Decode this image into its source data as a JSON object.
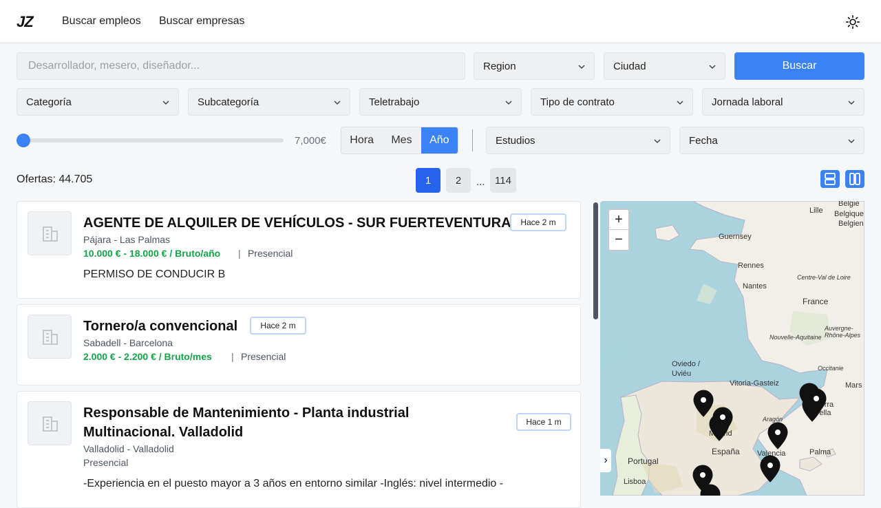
{
  "header": {
    "logo": "JZ",
    "nav": [
      "Buscar empleos",
      "Buscar empresas"
    ],
    "theme_icon": "sun-icon"
  },
  "filters": {
    "search_placeholder": "Desarrollador, mesero, diseñador...",
    "region": "Region",
    "ciudad": "Ciudad",
    "search_button": "Buscar",
    "categoria": "Categoría",
    "subcategoria": "Subcategoría",
    "teletrabajo": "Teletrabajo",
    "tipo_contrato": "Tipo de contrato",
    "jornada": "Jornada laboral",
    "salary_value": "7,000€",
    "period_options": [
      "Hora",
      "Mes",
      "Año"
    ],
    "period_selected": "Año",
    "estudios": "Estudios",
    "fecha": "Fecha"
  },
  "results": {
    "count_label": "Ofertas: 44.705",
    "pages": [
      "1",
      "2",
      "114"
    ],
    "ellipsis": "...",
    "current_page": "1"
  },
  "jobs": [
    {
      "title": "AGENTE DE ALQUILER DE VEHÍCULOS - SUR FUERTEVENTURA",
      "badge": "Hace 2 m",
      "location": "Pájara - Las Palmas",
      "salary": "10.000 € - 18.000 € / Bruto/año",
      "mode": "Presencial",
      "description": "PERMISO DE CONDUCIR B"
    },
    {
      "title": "Tornero/a convencional",
      "badge": "Hace 2 m",
      "location": "Sabadell - Barcelona",
      "salary": "2.000 € - 2.200 € / Bruto/mes",
      "mode": "Presencial"
    },
    {
      "title_line1": "Responsable de Mantenimiento - Planta industrial",
      "title_line2": "Multinacional. Valladolid",
      "badge": "Hace 1 m",
      "location": "Valladolid - Valladolid",
      "mode": "Presencial",
      "description": "-Experiencia en el puesto mayor a 3 años en entorno similar -Inglés: nivel intermedio -"
    }
  ],
  "map": {
    "zoom_in": "+",
    "zoom_out": "−",
    "labels": [
      "Lille",
      "Belgie",
      "Belgique",
      "Belgien",
      "Guernsey",
      "Rennes",
      "Nantes",
      "Centre-Val de Loire",
      "France",
      "Nouvelle-Aquitaine",
      "Auvergne-Rhône-Alpes",
      "Occitanie",
      "Mars",
      "Oviedo / Uviéu",
      "Vitoria-Gasteiz",
      "Madrid",
      "España",
      "Aragón",
      "Andorra la Vella",
      "Valencia",
      "Palma",
      "Portugal",
      "Lisboa"
    ],
    "collapse": "›"
  }
}
